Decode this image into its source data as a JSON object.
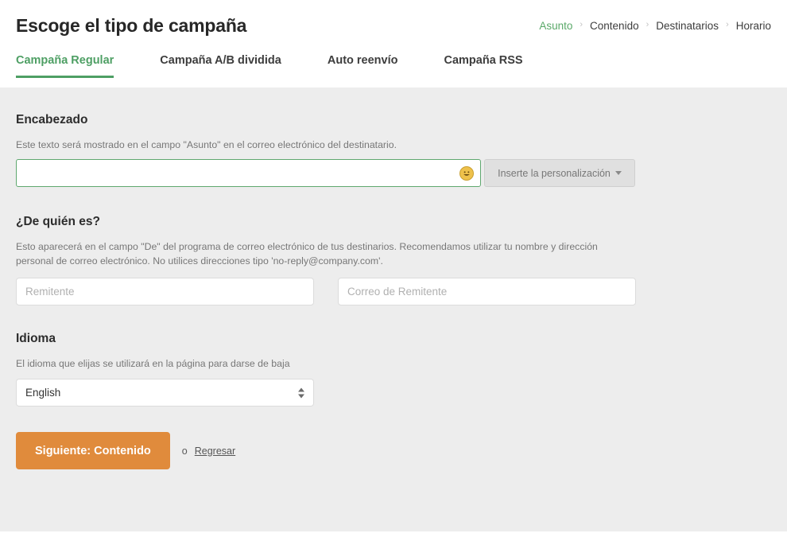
{
  "header": {
    "title": "Escoge el tipo de campaña",
    "breadcrumb": [
      {
        "label": "Asunto",
        "active": true
      },
      {
        "label": "Contenido",
        "active": false
      },
      {
        "label": "Destinatarios",
        "active": false
      },
      {
        "label": "Horario",
        "active": false
      }
    ],
    "separator": "›",
    "tabs": [
      {
        "label": "Campaña Regular",
        "active": true
      },
      {
        "label": "Campaña A/B dividida",
        "active": false
      },
      {
        "label": "Auto reenvío",
        "active": false
      },
      {
        "label": "Campaña RSS",
        "active": false
      }
    ]
  },
  "sections": {
    "encabezado": {
      "title": "Encabezado",
      "description": "Este texto será mostrado en el campo \"Asunto\" en el correo electrónico del destinatario.",
      "subject_value": "",
      "subject_placeholder": "",
      "emoji_icon": "smiley-face-icon",
      "personalize_label": "Inserte la personalización",
      "personalize_caret": "caret-down-icon"
    },
    "remitente": {
      "title": "¿De quién es?",
      "description": "Esto aparecerá en el campo \"De\" del programa de correo electrónico de tus destinarios. Recomendamos utilizar tu nombre y dirección personal de correo electrónico. No utilices direcciones tipo 'no-reply@company.com'.",
      "name_value": "",
      "name_placeholder": "Remitente",
      "email_value": "",
      "email_placeholder": "Correo de Remitente"
    },
    "idioma": {
      "title": "Idioma",
      "description": "El idioma que elijas se utilizará en la página para darse de baja",
      "selected": "English",
      "stepper_icon": "stepper-updown-icon"
    }
  },
  "actions": {
    "next_label": "Siguiente: Contenido",
    "or_label": "o",
    "back_label": "Regresar"
  },
  "colors": {
    "accent_green": "#4e9f64",
    "accent_orange": "#e08b3c",
    "page_background": "#ededed",
    "header_background": "#ffffff"
  }
}
